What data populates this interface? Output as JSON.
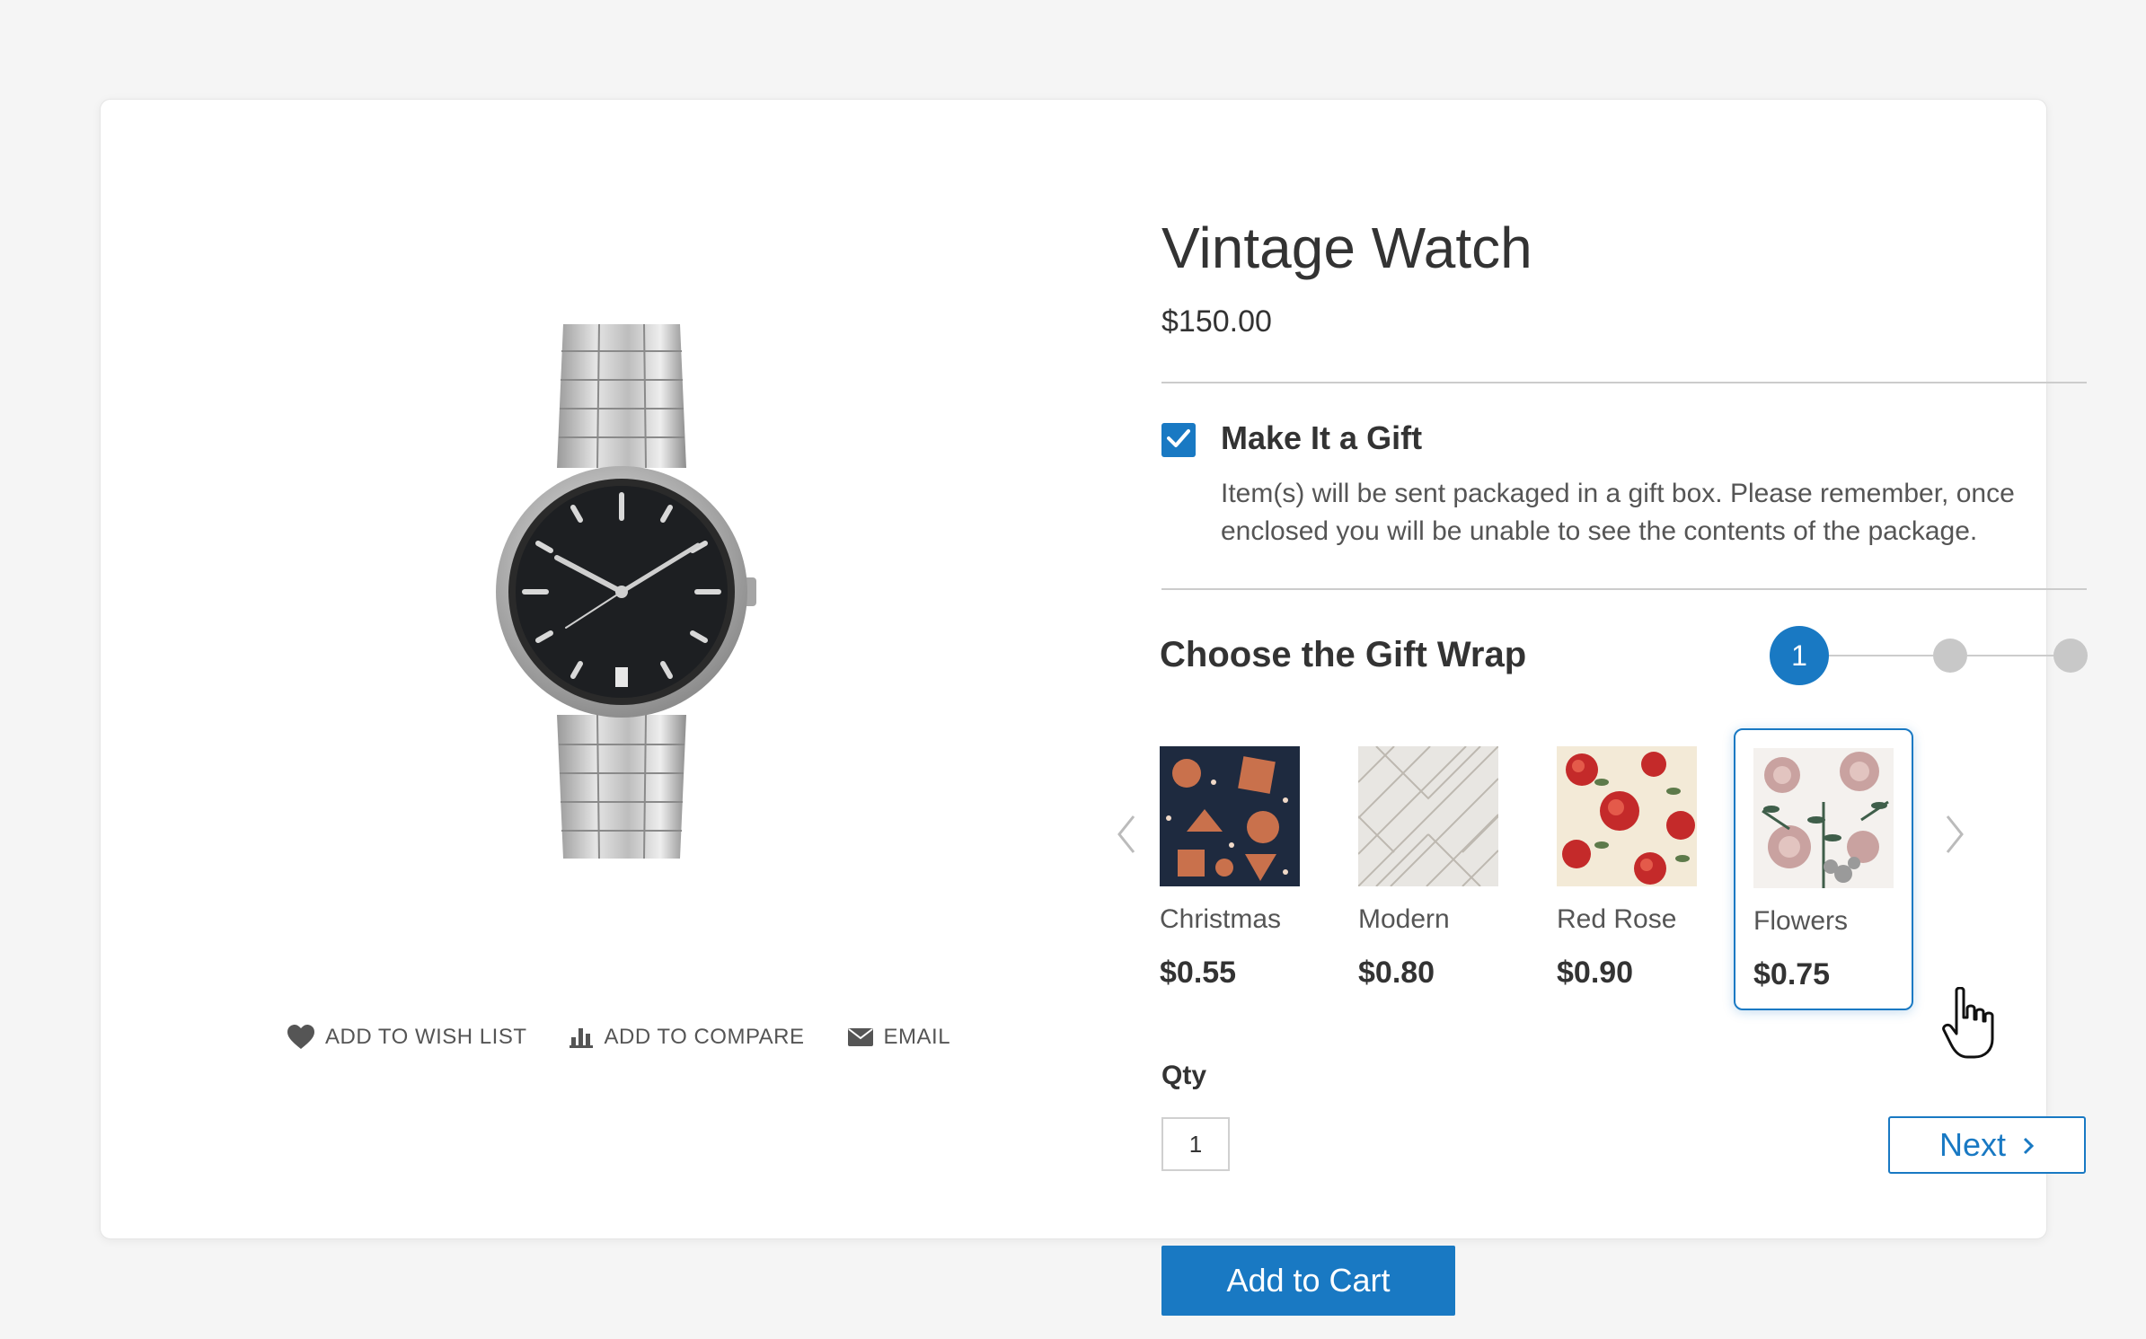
{
  "product": {
    "title": "Vintage Watch",
    "price": "$150.00"
  },
  "actions": [
    {
      "label": "ADD TO WISH LIST",
      "icon": "heart-icon"
    },
    {
      "label": "ADD TO COMPARE",
      "icon": "bar-chart-icon"
    },
    {
      "label": "EMAIL",
      "icon": "envelope-icon"
    }
  ],
  "gift": {
    "checked": true,
    "label": "Make It a Gift",
    "description": "Item(s) will be sent packaged in a gift box. Please remember, once enclosed you will be unable to see the contents of the package."
  },
  "gift_wrap": {
    "title": "Choose the Gift Wrap",
    "steps": {
      "current": "1",
      "total": 3
    },
    "items": [
      {
        "name": "Christmas",
        "price": "$0.55",
        "selected": false
      },
      {
        "name": "Modern",
        "price": "$0.80",
        "selected": false
      },
      {
        "name": "Red Rose",
        "price": "$0.90",
        "selected": false
      },
      {
        "name": "Flowers",
        "price": "$0.75",
        "selected": true
      }
    ]
  },
  "qty": {
    "label": "Qty",
    "value": "1"
  },
  "buttons": {
    "next": "Next",
    "add_to_cart": "Add to Cart"
  },
  "colors": {
    "accent": "#1979c3",
    "background": "#f5f5f5",
    "card": "#ffffff"
  }
}
